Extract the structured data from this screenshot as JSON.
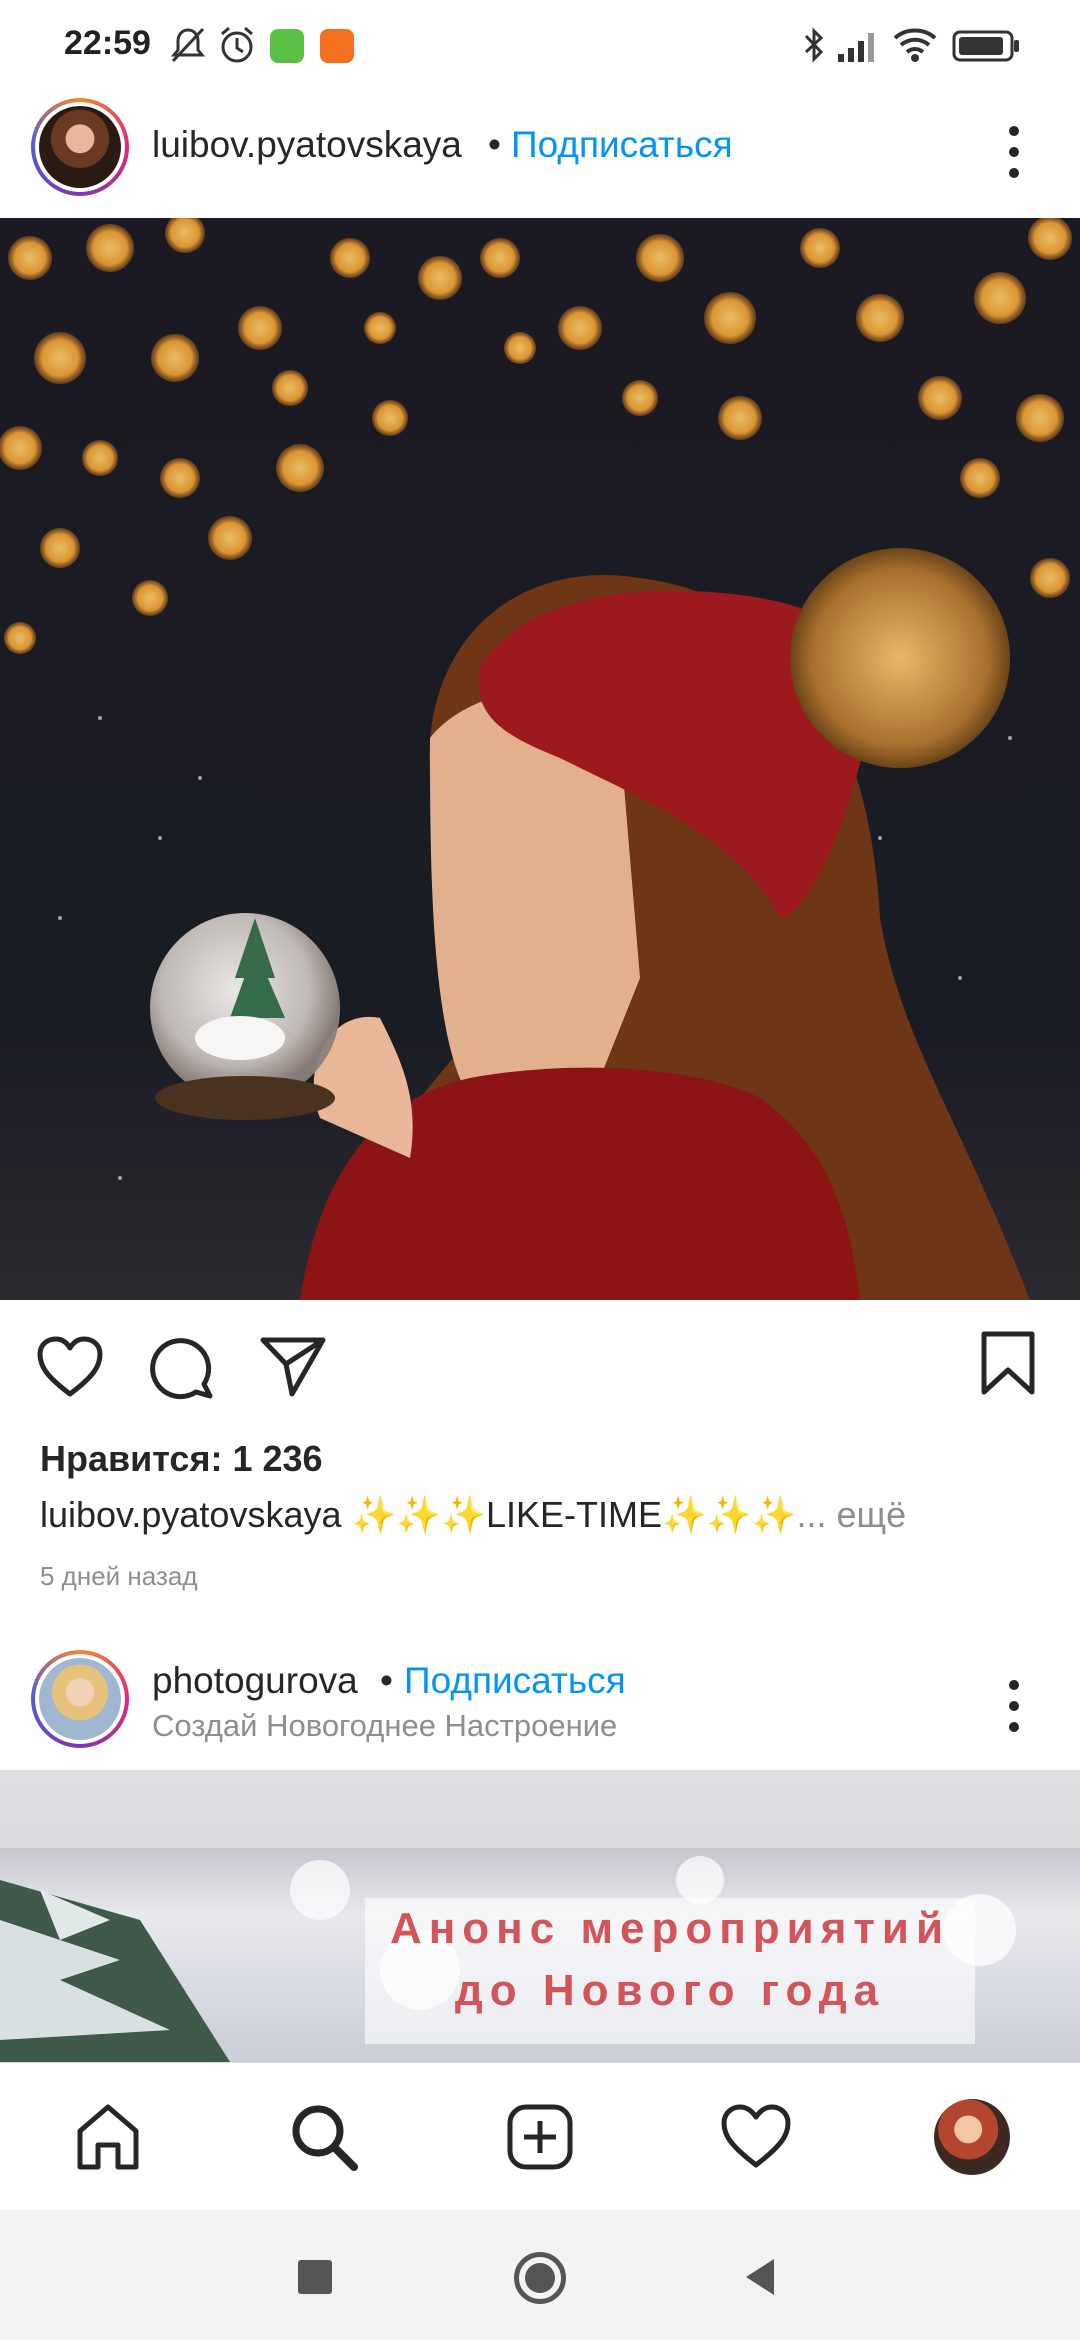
{
  "status_bar": {
    "time": "22:59",
    "icons": [
      "mute-icon",
      "alarm-icon",
      "app-notification-icon",
      "mi-icon",
      "bluetooth-icon",
      "signal-icon",
      "wifi-icon",
      "battery-icon"
    ]
  },
  "post1": {
    "username": "luibov.pyatovskaya",
    "separator": "•",
    "follow_label": "Подписаться",
    "likes": "Нравится: 1 236",
    "caption_user": "luibov.pyatovskaya",
    "caption_text": " ✨✨✨LIKE-TIME✨✨✨",
    "caption_more": "... ещё",
    "time_ago": "5 дней назад"
  },
  "post2": {
    "username": "photogurova",
    "separator": "•",
    "follow_label": "Подписаться",
    "subtitle": "Создай Новогоднее Настроение",
    "overlay_line1": "Анонс мероприятий",
    "overlay_line2": "до Нового года"
  },
  "bottom_nav": [
    "home-icon",
    "search-icon",
    "new-post-icon",
    "activity-icon",
    "profile-avatar"
  ],
  "system_nav": [
    "recents-button",
    "home-button",
    "back-button"
  ],
  "colors": {
    "accent": "#0095f6",
    "text": "#262626",
    "muted": "#8e8e8e"
  }
}
